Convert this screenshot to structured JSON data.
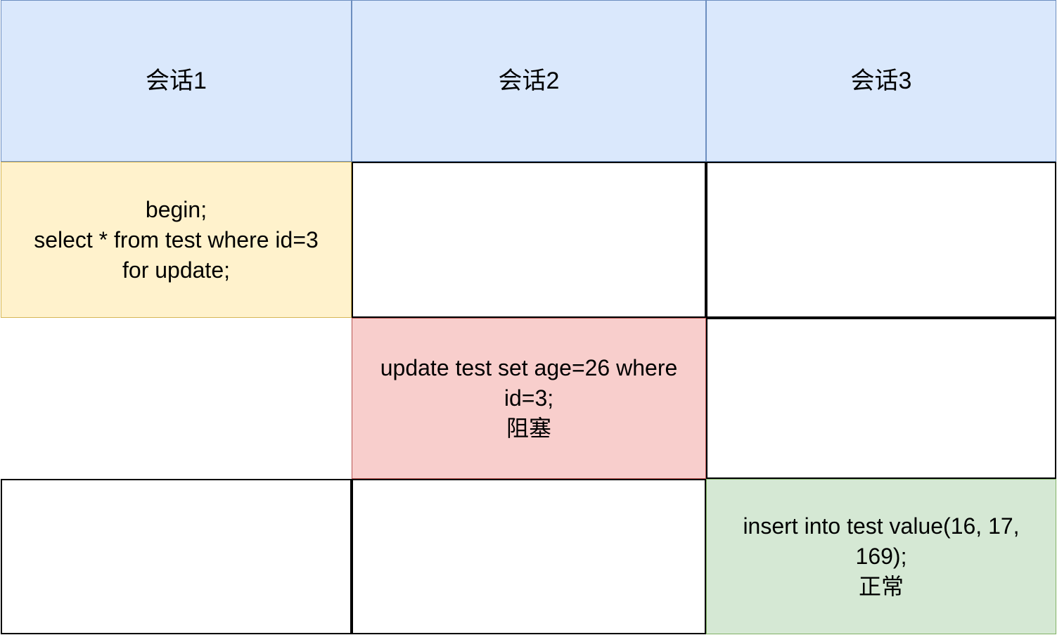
{
  "header": {
    "session1": "会话1",
    "session2": "会话2",
    "session3": "会话3"
  },
  "rows": [
    {
      "session1": "begin;\nselect * from test where id=3\nfor update;",
      "session2": "",
      "session3": ""
    },
    {
      "session1": "",
      "session2": "update test set age=26 where\nid=3;\n阻塞",
      "session3": ""
    },
    {
      "session1": "",
      "session2": "",
      "session3": "insert into test value(16, 17,\n169);\n正常"
    }
  ],
  "colors": {
    "header_fill": "#dae8fc",
    "header_border": "#6c8ebf",
    "lock_fill": "#fff2cc",
    "blocked_fill": "#f8cecc",
    "normal_fill": "#d5e8d4"
  }
}
